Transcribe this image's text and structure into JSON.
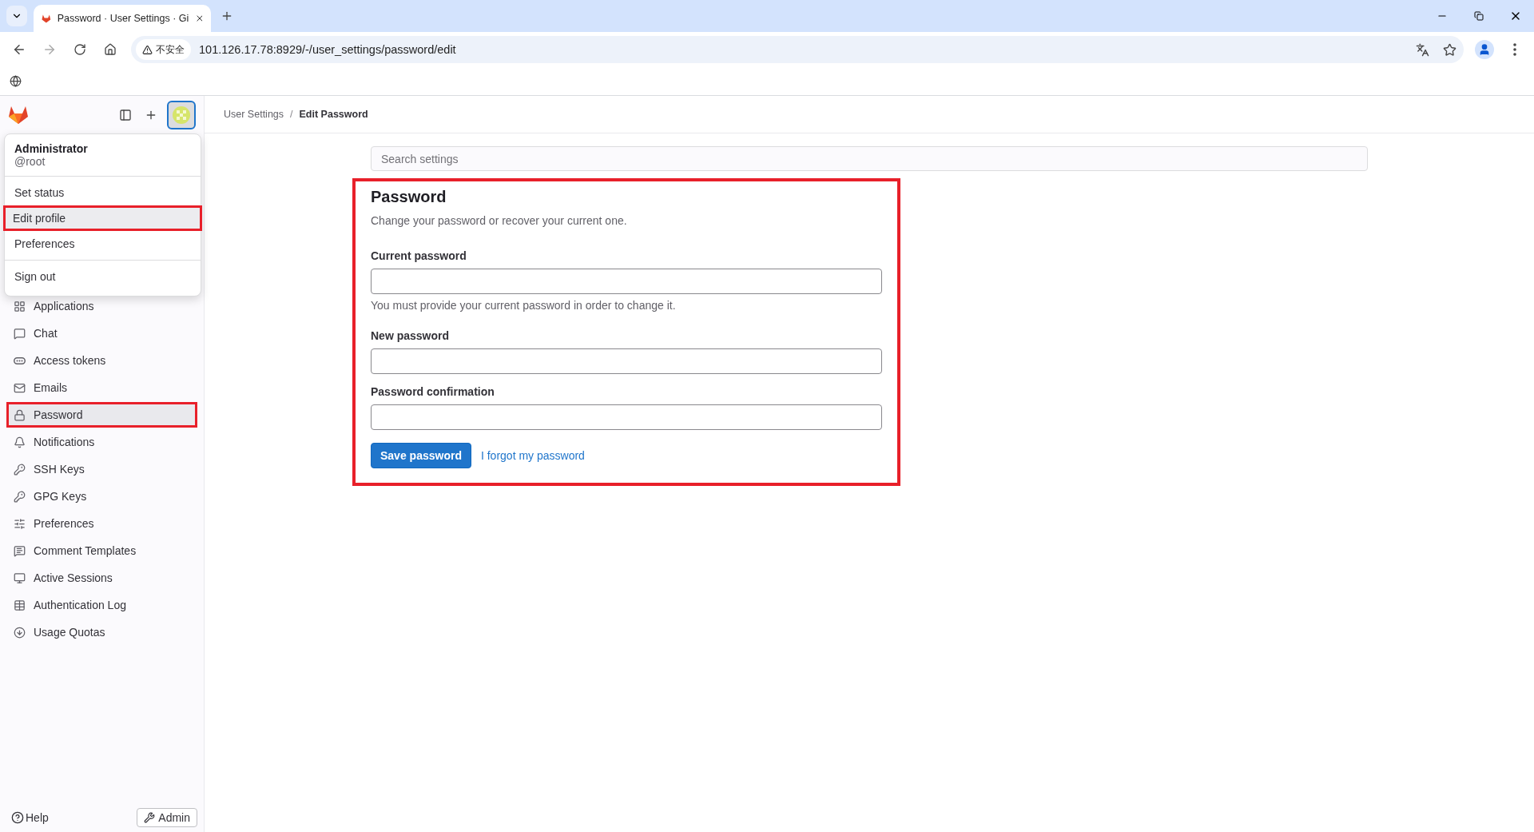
{
  "browser": {
    "tab_title": "Password · User Settings · Gi",
    "security_label": "不安全",
    "url": "101.126.17.78:8929/-/user_settings/password/edit"
  },
  "breadcrumb": {
    "separator": "/",
    "items": [
      {
        "label": "User Settings",
        "current": false
      },
      {
        "label": "Edit Password",
        "current": true
      }
    ]
  },
  "user_menu": {
    "name": "Administrator",
    "handle": "@root",
    "items": [
      {
        "label": "Set status",
        "selected": false,
        "annotated": false
      },
      {
        "label": "Edit profile",
        "selected": true,
        "annotated": true
      },
      {
        "label": "Preferences",
        "selected": false,
        "annotated": false
      },
      {
        "label": "Sign out",
        "selected": false,
        "annotated": false
      }
    ]
  },
  "sidebar": {
    "items": [
      {
        "label": "Applications",
        "selected": false,
        "annotated": false
      },
      {
        "label": "Chat",
        "selected": false,
        "annotated": false
      },
      {
        "label": "Access tokens",
        "selected": false,
        "annotated": false
      },
      {
        "label": "Emails",
        "selected": false,
        "annotated": false
      },
      {
        "label": "Password",
        "selected": true,
        "annotated": true
      },
      {
        "label": "Notifications",
        "selected": false,
        "annotated": false
      },
      {
        "label": "SSH Keys",
        "selected": false,
        "annotated": false
      },
      {
        "label": "GPG Keys",
        "selected": false,
        "annotated": false
      },
      {
        "label": "Preferences",
        "selected": false,
        "annotated": false
      },
      {
        "label": "Comment Templates",
        "selected": false,
        "annotated": false
      },
      {
        "label": "Active Sessions",
        "selected": false,
        "annotated": false
      },
      {
        "label": "Authentication Log",
        "selected": false,
        "annotated": false
      },
      {
        "label": "Usage Quotas",
        "selected": false,
        "annotated": false
      }
    ],
    "help": "Help",
    "admin": "Admin"
  },
  "search": {
    "placeholder": "Search settings"
  },
  "form": {
    "annotated": true,
    "title": "Password",
    "description": "Change your password or recover your current one.",
    "fields": [
      {
        "label": "Current password",
        "hint": "You must provide your current password in order to change it."
      },
      {
        "label": "New password"
      },
      {
        "label": "Password confirmation"
      }
    ],
    "submit": "Save password",
    "link": "I forgot my password"
  }
}
